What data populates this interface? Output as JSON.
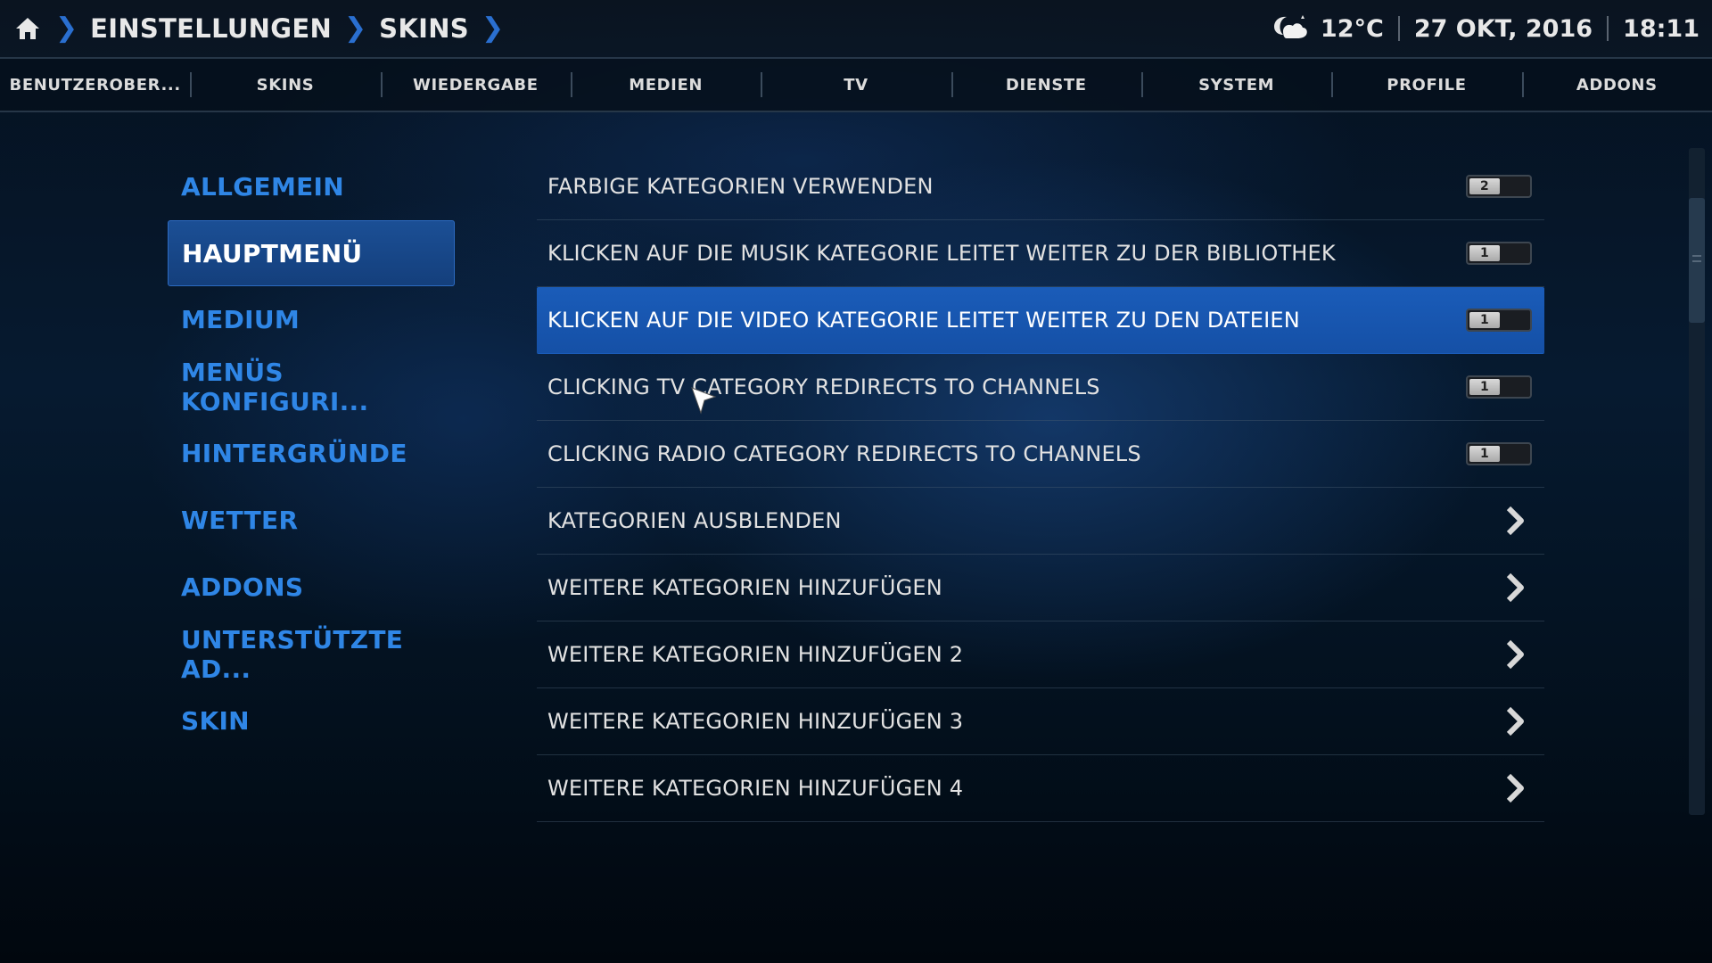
{
  "header": {
    "breadcrumbs": [
      "EINSTELLUNGEN",
      "SKINS"
    ],
    "weather_icon": "partly-cloudy-night-icon",
    "temperature": "12°C",
    "date": "27 OKT, 2016",
    "time": "18:11"
  },
  "tabs": [
    "BENUTZEROBER...",
    "SKINS",
    "WIEDERGABE",
    "MEDIEN",
    "TV",
    "DIENSTE",
    "SYSTEM",
    "PROFILE",
    "ADDONS"
  ],
  "left_menu": {
    "items": [
      "ALLGEMEIN",
      "HAUPTMENÜ",
      "MEDIUM",
      "MENÜS KONFIGURI...",
      "HINTERGRÜNDE",
      "WETTER",
      "ADDONS",
      "UNTERSTÜTZTE AD...",
      "SKIN"
    ],
    "active": "HAUPTMENÜ"
  },
  "settings": {
    "rows": [
      {
        "label": "FARBIGE KATEGORIEN VERWENDEN",
        "control": "toggle",
        "state": "off",
        "knob_text": "2"
      },
      {
        "label": "KLICKEN AUF DIE MUSIK KATEGORIE LEITET WEITER ZU DER BIBLIOTHEK",
        "control": "toggle",
        "state": "on",
        "knob_text": "1"
      },
      {
        "label": "KLICKEN AUF DIE VIDEO KATEGORIE LEITET WEITER ZU DEN DATEIEN",
        "control": "toggle",
        "state": "on",
        "knob_text": "1",
        "selected": true
      },
      {
        "label": "CLICKING TV CATEGORY REDIRECTS TO CHANNELS",
        "control": "toggle",
        "state": "on",
        "knob_text": "1"
      },
      {
        "label": "CLICKING RADIO CATEGORY REDIRECTS TO CHANNELS",
        "control": "toggle",
        "state": "on",
        "knob_text": "1"
      },
      {
        "label": "KATEGORIEN AUSBLENDEN",
        "control": "arrow"
      },
      {
        "label": "WEITERE KATEGORIEN HINZUFÜGEN",
        "control": "arrow"
      },
      {
        "label": "WEITERE KATEGORIEN HINZUFÜGEN 2",
        "control": "arrow"
      },
      {
        "label": "WEITERE KATEGORIEN HINZUFÜGEN 3",
        "control": "arrow"
      },
      {
        "label": "WEITERE KATEGORIEN HINZUFÜGEN 4",
        "control": "arrow"
      }
    ]
  },
  "colors": {
    "accent": "#2f86e6",
    "selected_row": "#1a5cb9",
    "breadcrumb_separator": "#2a6fd0"
  },
  "scrollbar": {
    "position_fraction": 0.08
  }
}
